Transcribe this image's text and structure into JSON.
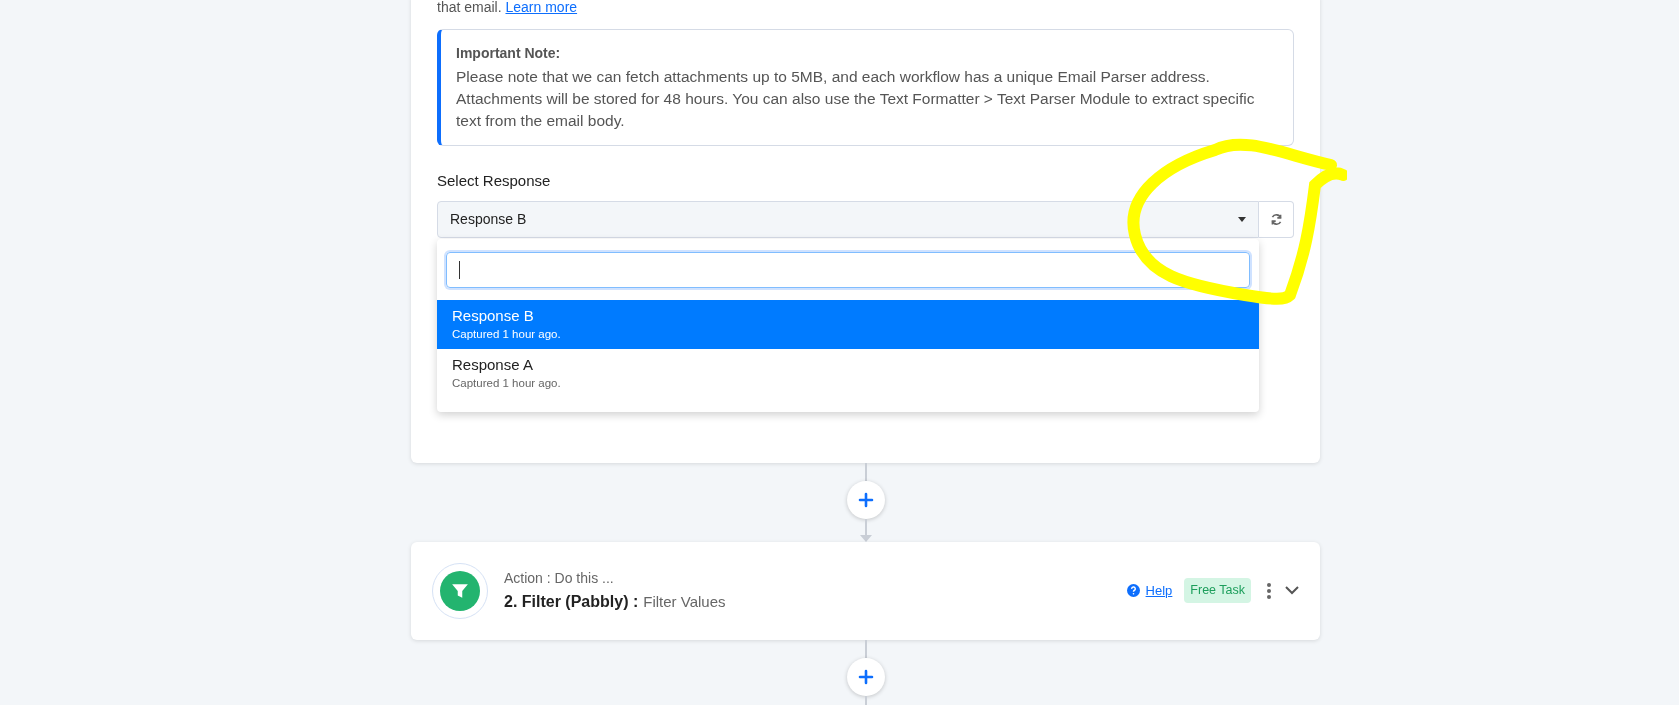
{
  "intro": {
    "text": "that email.",
    "link": "Learn more"
  },
  "note": {
    "title": "Important Note:",
    "text": "Please note that we can fetch attachments up to 5MB, and each workflow has a unique Email Parser address. Attachments will be stored for 48 hours. You can also use the Text Formatter > Text Parser Module to extract specific text from the email body."
  },
  "select": {
    "label": "Select Response",
    "value": "Response B",
    "expanded": true,
    "options": [
      {
        "title": "Response B",
        "subtitle": "Captured 1 hour ago.",
        "selected": true
      },
      {
        "title": "Response A",
        "subtitle": "Captured 1 hour ago.",
        "selected": false
      }
    ]
  },
  "step": {
    "kicker": "Action : Do this ...",
    "title": "2. Filter (Pabbly) :",
    "event": "Filter Values",
    "help": "Help",
    "badge": "Free Task"
  }
}
